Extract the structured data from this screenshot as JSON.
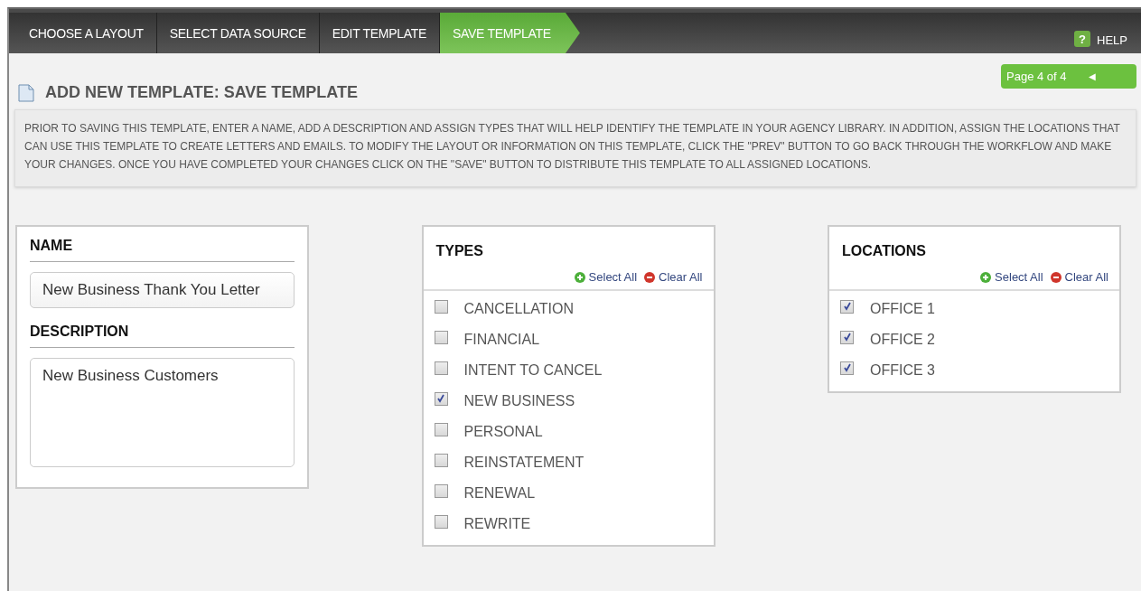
{
  "tabs": [
    {
      "label": "CHOOSE A LAYOUT",
      "selected": false
    },
    {
      "label": "SELECT DATA SOURCE",
      "selected": false
    },
    {
      "label": "EDIT TEMPLATE",
      "selected": false
    },
    {
      "label": "SAVE TEMPLATE",
      "selected": true
    }
  ],
  "help": {
    "icon": "?",
    "label": "HELP"
  },
  "pager": {
    "label": "Page 4 of 4",
    "arrow": "◀"
  },
  "page_title": "ADD NEW TEMPLATE: SAVE TEMPLATE",
  "instructions": "PRIOR TO SAVING THIS TEMPLATE, ENTER A NAME, ADD A DESCRIPTION AND ASSIGN TYPES THAT WILL HELP IDENTIFY THE TEMPLATE IN YOUR AGENCY LIBRARY. IN ADDITION, ASSIGN THE LOCATIONS THAT CAN USE THIS TEMPLATE TO CREATE LETTERS AND EMAILS. TO MODIFY THE LAYOUT OR INFORMATION ON THIS TEMPLATE, CLICK THE \"PREV\" BUTTON TO GO BACK THROUGH THE WORKFLOW AND MAKE YOUR CHANGES. ONCE YOU HAVE COMPLETED YOUR CHANGES CLICK ON THE \"SAVE\" BUTTON TO DISTRIBUTE THIS TEMPLATE TO ALL ASSIGNED LOCATIONS.",
  "name_panel": {
    "name_label": "NAME",
    "name_value": "New Business Thank You Letter",
    "description_label": "DESCRIPTION",
    "description_value": "New Business Customers"
  },
  "types": {
    "title": "TYPES",
    "select_all": "Select All",
    "clear_all": "Clear All",
    "items": [
      {
        "label": "CANCELLATION",
        "checked": false
      },
      {
        "label": "FINANCIAL",
        "checked": false
      },
      {
        "label": "INTENT TO CANCEL",
        "checked": false
      },
      {
        "label": "NEW BUSINESS",
        "checked": true
      },
      {
        "label": "PERSONAL",
        "checked": false
      },
      {
        "label": "REINSTATEMENT",
        "checked": false
      },
      {
        "label": "RENEWAL",
        "checked": false
      },
      {
        "label": "REWRITE",
        "checked": false
      }
    ]
  },
  "locations": {
    "title": "LOCATIONS",
    "select_all": "Select All",
    "clear_all": "Clear All",
    "items": [
      {
        "label": "OFFICE 1",
        "checked": true
      },
      {
        "label": "OFFICE 2",
        "checked": true
      },
      {
        "label": "OFFICE 3",
        "checked": true
      }
    ]
  }
}
